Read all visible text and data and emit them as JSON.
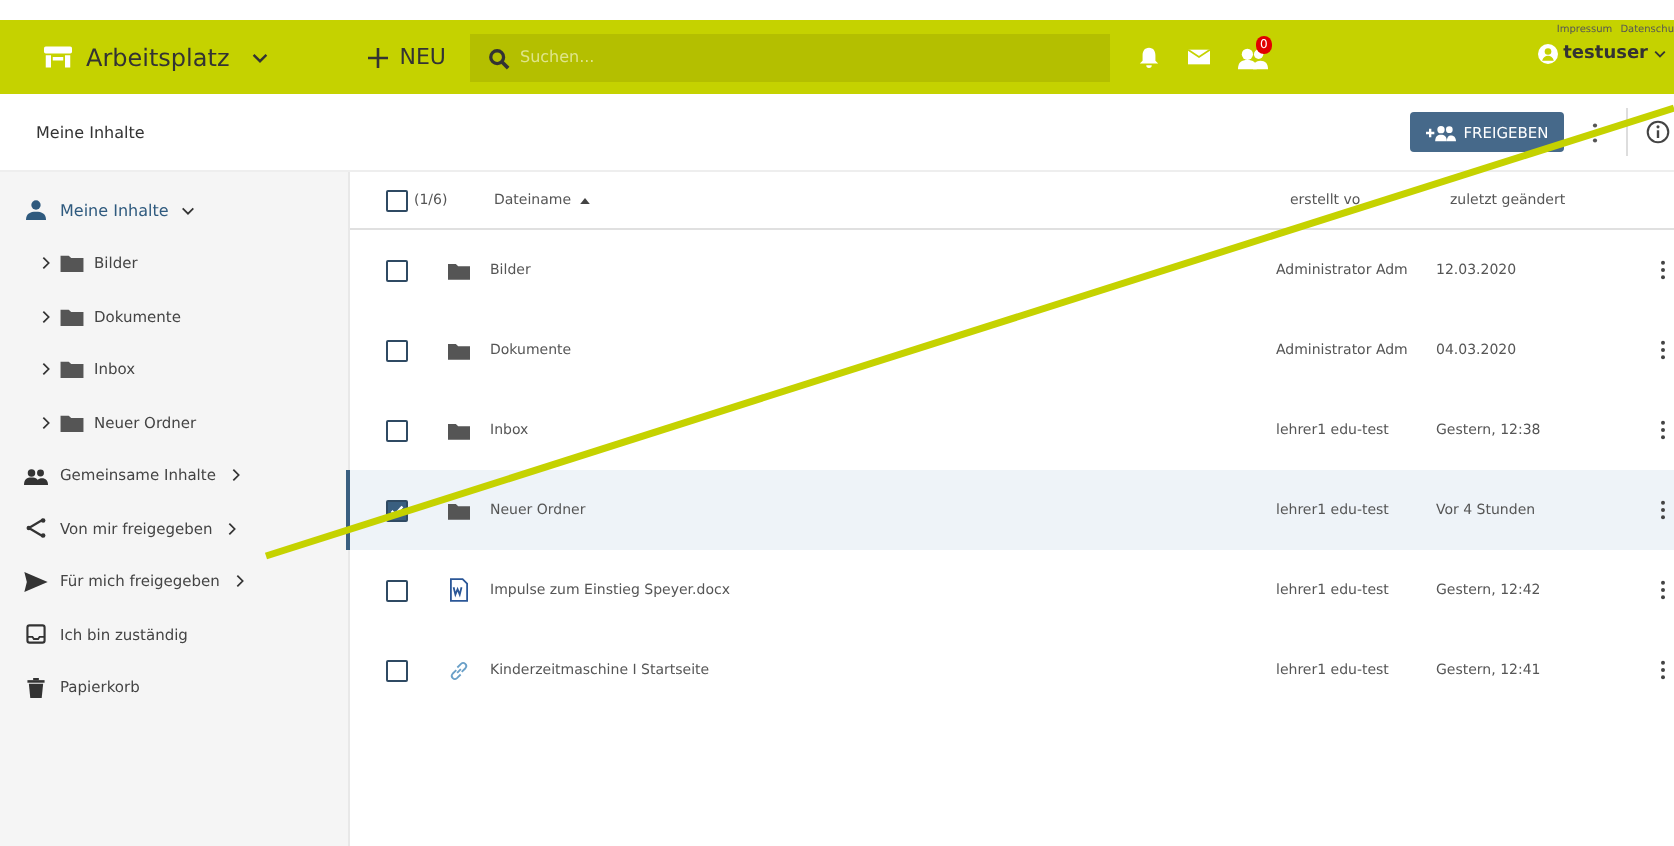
{
  "topbar": {
    "workspace": "Arbeitsplatz",
    "new_label": "NEU",
    "search": {
      "placeholder": "Suchen..."
    },
    "badge": "0",
    "links": [
      "Impressum",
      "Datenschu"
    ],
    "user": "testuser"
  },
  "header": {
    "title": "Meine Inhalte",
    "share_button": "FREIGEBEN"
  },
  "sidebar": {
    "items": [
      {
        "label": "Meine Inhalte",
        "kind": "user",
        "expanded": true,
        "children": [
          {
            "label": "Bilder",
            "kind": "folder"
          },
          {
            "label": "Dokumente",
            "kind": "folder"
          },
          {
            "label": "Inbox",
            "kind": "folder"
          },
          {
            "label": "Neuer Ordner",
            "kind": "folder"
          }
        ]
      },
      {
        "label": "Gemeinsame Inhalte",
        "kind": "group",
        "expanded": false
      },
      {
        "label": "Von mir freigegeben",
        "kind": "share",
        "expanded": false
      },
      {
        "label": "Für mich freigegeben",
        "kind": "send",
        "expanded": false
      },
      {
        "label": "Ich bin zuständig",
        "kind": "inbox"
      },
      {
        "label": "Papierkorb",
        "kind": "trash"
      }
    ]
  },
  "table": {
    "select_all_checked": false,
    "count": "(1/6)",
    "columns": [
      "Dateiname",
      "erstellt vo",
      "zuletzt geändert"
    ],
    "rows": [
      {
        "name": "Bilder",
        "kind": "folder",
        "creator": "Administrator Adm",
        "modified": "12.03.2020",
        "selected": false
      },
      {
        "name": "Dokumente",
        "kind": "folder",
        "creator": "Administrator Adm",
        "modified": "04.03.2020",
        "selected": false
      },
      {
        "name": "Inbox",
        "kind": "folder",
        "creator": "lehrer1 edu-test",
        "modified": "Gestern, 12:38",
        "selected": false
      },
      {
        "name": "Neuer Ordner",
        "kind": "folder",
        "creator": "lehrer1 edu-test",
        "modified": "Vor 4 Stunden",
        "selected": true
      },
      {
        "name": "Impulse zum Einstieg Speyer.docx",
        "kind": "word",
        "creator": "lehrer1 edu-test",
        "modified": "Gestern, 12:42",
        "selected": false
      },
      {
        "name": "Kinderzeitmaschine I Startseite",
        "kind": "link",
        "creator": "lehrer1 edu-test",
        "modified": "Gestern, 12:41",
        "selected": false
      }
    ]
  }
}
